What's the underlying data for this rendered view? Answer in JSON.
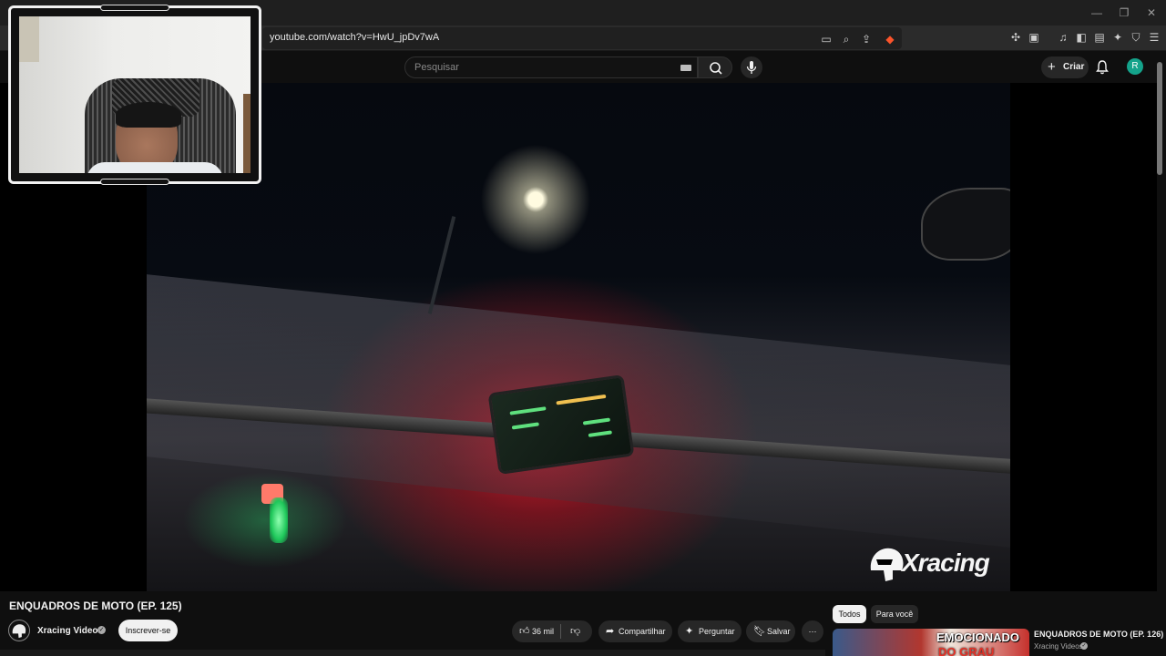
{
  "browser": {
    "url": "youtube.com/watch?v=HwU_jpDv7wA",
    "window_controls": [
      "—",
      "❐",
      "✕"
    ]
  },
  "header": {
    "search_placeholder": "Pesquisar",
    "create_label": "Criar",
    "avatar_letter": "R"
  },
  "video": {
    "brand_text": "Xracing",
    "title": "ENQUADROS DE MOTO (EP. 125)"
  },
  "channel": {
    "name": "Xracing Videos",
    "subscribe_label": "Inscrever-se"
  },
  "actions": {
    "likes": "36 mil",
    "share": "Compartilhar",
    "ask": "Perguntar",
    "save": "Salvar"
  },
  "sidebar": {
    "chips": [
      "Todos",
      "Para você"
    ],
    "recommendation": {
      "thumb_line1": "EMOCIONADO",
      "thumb_line2": "DO GRAU",
      "title": "ENQUADROS DE MOTO (EP. 126)",
      "channel": "Xracing Videos"
    }
  },
  "colors": {
    "background": "#0f0f0f",
    "avatar": "#14a38b",
    "chip_active": "#f1f1f1"
  }
}
